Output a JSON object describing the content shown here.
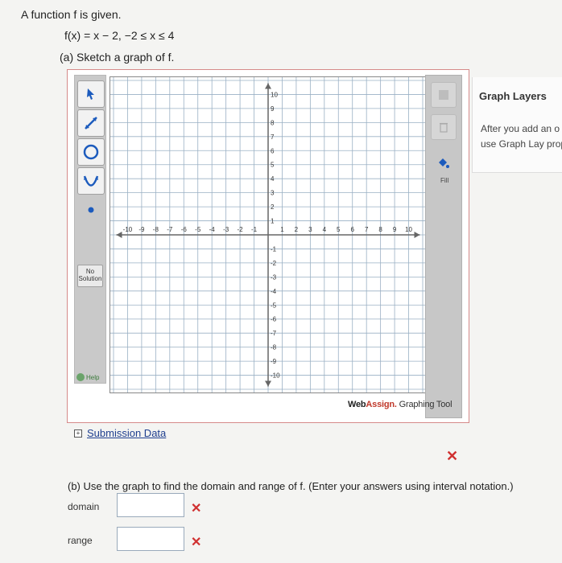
{
  "question": {
    "intro": "A function f is given.",
    "function_def": "f(x) = x − 2,   −2 ≤ x ≤ 4",
    "part_a": "(a) Sketch a graph of f.",
    "part_b": "(b) Use the graph to find the domain and range of f. (Enter your answers using interval notation.)"
  },
  "toolbox": {
    "tools": [
      {
        "icon": "pointer-icon"
      },
      {
        "icon": "line-icon"
      },
      {
        "icon": "circle-icon"
      },
      {
        "icon": "parabola-icon"
      },
      {
        "icon": "point-icon"
      }
    ],
    "no_solution_label": "No Solution",
    "help_label": "Help"
  },
  "side_panel": {
    "fill_label": "Fill"
  },
  "graph": {
    "x_ticks": [
      "-10",
      "-9",
      "-8",
      "-7",
      "-6",
      "-5",
      "-4",
      "-3",
      "-2",
      "-1",
      "1",
      "2",
      "3",
      "4",
      "5",
      "6",
      "7",
      "8",
      "9",
      "10"
    ],
    "y_ticks": [
      "10",
      "9",
      "8",
      "7",
      "6",
      "5",
      "4",
      "3",
      "2",
      "1",
      "-1",
      "-2",
      "-3",
      "-4",
      "-5",
      "-6",
      "-7",
      "-8",
      "-9",
      "-10"
    ],
    "x_range": [
      -10,
      10
    ],
    "y_range": [
      -10,
      10
    ]
  },
  "branding": {
    "web": "Web",
    "assign": "Assign.",
    "rest": " Graphing Tool"
  },
  "layers": {
    "title": "Graph Layers",
    "text": "After you add an o can use Graph Lay properties."
  },
  "submission": {
    "label": "Submission Data"
  },
  "answers": {
    "domain_label": "domain",
    "range_label": "range",
    "domain_value": "",
    "range_value": ""
  },
  "colors": {
    "accent_red": "#d03030",
    "brand_red": "#c0392b",
    "link_blue": "#1f3f8f"
  }
}
